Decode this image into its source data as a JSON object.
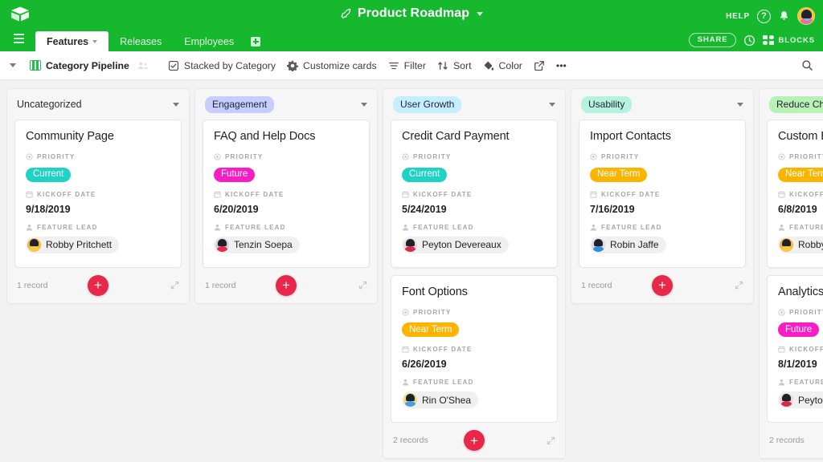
{
  "header": {
    "logo_name": "airtable-logo",
    "doc_title": "Product Roadmap",
    "doc_icon": "rocket-icon",
    "help_label": "HELP",
    "question_glyph": "?",
    "share_label": "SHARE",
    "blocks_label": "BLOCKS",
    "tabs": [
      {
        "label": "Features",
        "active": true
      },
      {
        "label": "Releases",
        "active": false
      },
      {
        "label": "Employees",
        "active": false
      }
    ],
    "add_tab_label": "+"
  },
  "toolbar": {
    "view_name": "Category Pipeline",
    "stack_label": "Stacked by Category",
    "customize_label": "Customize cards",
    "filter_label": "Filter",
    "sort_label": "Sort",
    "color_label": "Color",
    "more_label": "•••"
  },
  "fields": {
    "priority": "PRIORITY",
    "kickoff": "KICKOFF DATE",
    "lead": "FEATURE LEAD"
  },
  "stacks": [
    {
      "title": "Uncategorized",
      "chip": false,
      "chip_bg": "transparent",
      "record_count": "1 record",
      "cards": [
        {
          "title": "Community Page",
          "priority": "Current",
          "priority_color": "#1fd3c4",
          "kickoff": "9/18/2019",
          "lead": "Robby Pritchett",
          "avatar_bg": "#f3b73f",
          "avatar_body": "#f7c948"
        }
      ]
    },
    {
      "title": "Engagement",
      "chip": true,
      "chip_bg": "#c7ceff",
      "record_count": "1 record",
      "cards": [
        {
          "title": "FAQ and Help Docs",
          "priority": "Future",
          "priority_color": "#f81ec6",
          "kickoff": "6/20/2019",
          "lead": "Tenzin Soepa",
          "avatar_bg": "#cfd3e0",
          "avatar_body": "#e8294b"
        }
      ]
    },
    {
      "title": "User Growth",
      "chip": true,
      "chip_bg": "#c5eeff",
      "record_count": "2 records",
      "cards": [
        {
          "title": "Credit Card Payment",
          "priority": "Current",
          "priority_color": "#1fd3c4",
          "kickoff": "5/24/2019",
          "lead": "Peyton Devereaux",
          "avatar_bg": "#f5d3dd",
          "avatar_body": "#d32a4e"
        },
        {
          "title": "Font Options",
          "priority": "Near Term",
          "priority_color": "#fcb400",
          "kickoff": "6/26/2019",
          "lead": "Rin O'Shea",
          "avatar_bg": "#f2d97f",
          "avatar_body": "#4a9fe0"
        }
      ]
    },
    {
      "title": "Usability",
      "chip": true,
      "chip_bg": "#b6f2e0",
      "record_count": "1 record",
      "cards": [
        {
          "title": "Import Contacts",
          "priority": "Near Term",
          "priority_color": "#fcb400",
          "kickoff": "7/16/2019",
          "lead": "Robin Jaffe",
          "avatar_bg": "#e4d6ef",
          "avatar_body": "#2b8fd8"
        }
      ]
    },
    {
      "title": "Reduce Churn",
      "chip": true,
      "chip_bg": "#b9f0b6",
      "record_count": "2 records",
      "cards": [
        {
          "title": "Custom Branding",
          "priority": "Near Term",
          "priority_color": "#fcb400",
          "kickoff": "6/8/2019",
          "lead": "Robby Pritchett",
          "avatar_bg": "#f3b73f",
          "avatar_body": "#f7c948"
        },
        {
          "title": "Analytics",
          "priority": "Future",
          "priority_color": "#f81ec6",
          "kickoff": "8/1/2019",
          "lead": "Peyton Devereaux",
          "avatar_bg": "#f5d3dd",
          "avatar_body": "#d32a4e"
        }
      ]
    }
  ],
  "colors": {
    "header_green": "#16b82e",
    "fab_red": "#e8274b",
    "board_bg": "#f2f2f2"
  }
}
